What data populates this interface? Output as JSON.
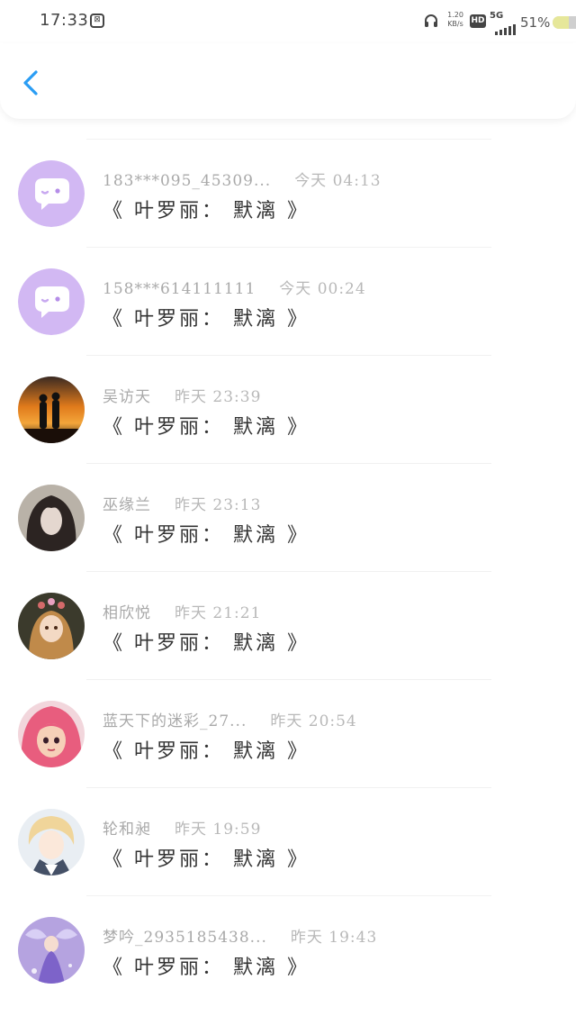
{
  "status_bar": {
    "time": "17:33",
    "speed": "1.20",
    "speed_unit": "KB/s",
    "hd": "HD",
    "network": "5G",
    "battery": "51%",
    "battery_level": 0.51
  },
  "header": {
    "back_icon": "chevron-left-icon",
    "accent_color": "#2a9df4"
  },
  "messages": [
    {
      "sender": "183***095_45309...",
      "time": "今天 04:13",
      "text": "《 叶罗丽： 默漓 》",
      "avatar": "default-chat-bubble"
    },
    {
      "sender": "158***614111111",
      "time": "今天 00:24",
      "text": "《 叶罗丽： 默漓 》",
      "avatar": "default-chat-bubble"
    },
    {
      "sender": "吴访天",
      "time": "昨天 23:39",
      "text": "《 叶罗丽： 默漓 》",
      "avatar": "sunset-couple"
    },
    {
      "sender": "巫缘兰",
      "time": "昨天 23:13",
      "text": "《 叶罗丽： 默漓 》",
      "avatar": "dark-haired-girl"
    },
    {
      "sender": "相欣悦",
      "time": "昨天 21:21",
      "text": "《 叶罗丽： 默漓 》",
      "avatar": "doll"
    },
    {
      "sender": "蓝天下的迷彩_27...",
      "time": "昨天 20:54",
      "text": "《 叶罗丽： 默漓 》",
      "avatar": "pink-haired-girl"
    },
    {
      "sender": "轮和昶",
      "time": "昨天 19:59",
      "text": "《 叶罗丽： 默漓 》",
      "avatar": "blond-anime-boy"
    },
    {
      "sender": "梦吟_2935185438...",
      "time": "昨天 19:43",
      "text": "《 叶罗丽： 默漓 》",
      "avatar": "fairy-purple"
    }
  ]
}
